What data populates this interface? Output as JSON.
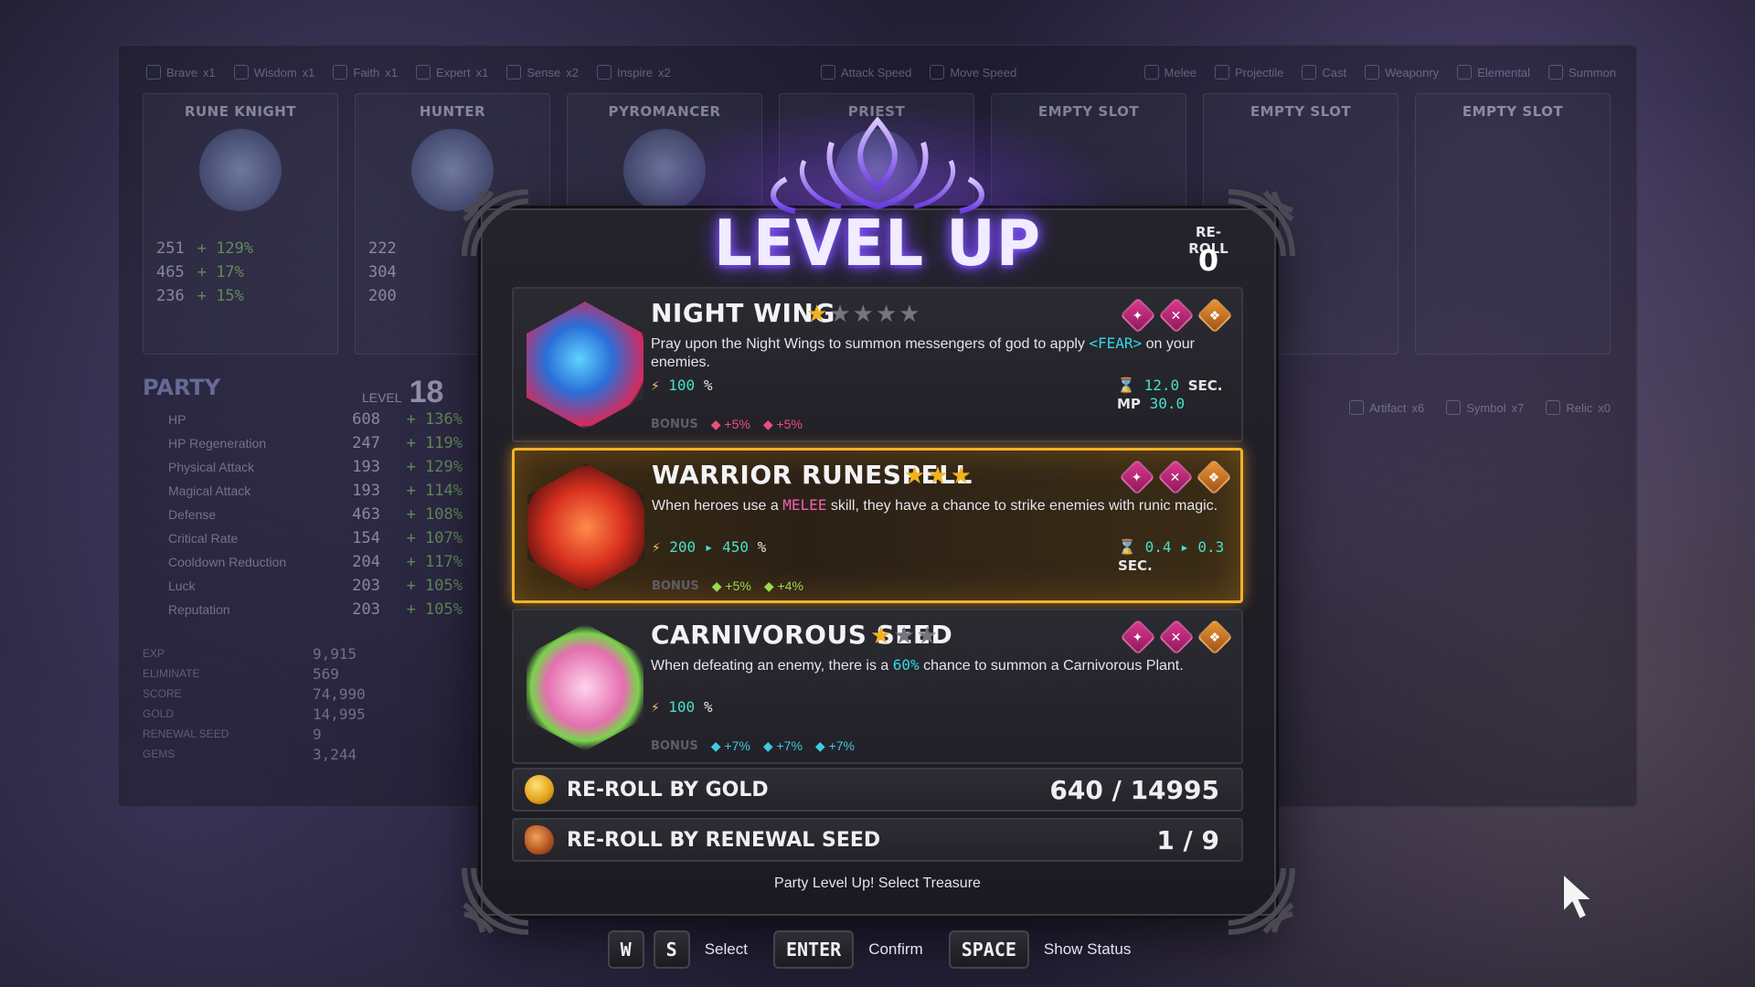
{
  "background": {
    "traits_left": [
      {
        "label": "Brave",
        "count": "x1"
      },
      {
        "label": "Wisdom",
        "count": "x1"
      },
      {
        "label": "Faith",
        "count": "x1"
      },
      {
        "label": "Expert",
        "count": "x1"
      },
      {
        "label": "Sense",
        "count": "x2"
      },
      {
        "label": "Inspire",
        "count": "x2"
      }
    ],
    "traits_mid": [
      "Attack Speed",
      "Move Speed"
    ],
    "traits_right": [
      "Melee",
      "Projectile",
      "Cast",
      "Weaponry",
      "Elemental",
      "Summon"
    ],
    "heroes": [
      {
        "name": "RUNE KNIGHT",
        "stats": [
          {
            "v": "251",
            "p": "+ 129%"
          },
          {
            "v": "465",
            "p": "+ 17%"
          },
          {
            "v": "236",
            "p": "+ 15%"
          }
        ]
      },
      {
        "name": "HUNTER",
        "stats": [
          {
            "v": "222",
            "p": ""
          },
          {
            "v": "304",
            "p": ""
          },
          {
            "v": "200",
            "p": ""
          }
        ]
      },
      {
        "name": "PYROMANCER",
        "stats": []
      },
      {
        "name": "PRIEST",
        "stats": []
      },
      {
        "name": "EMPTY SLOT",
        "stats": []
      },
      {
        "name": "EMPTY SLOT",
        "stats": []
      },
      {
        "name": "EMPTY SLOT",
        "stats": []
      }
    ],
    "party": {
      "title": "PARTY",
      "level_label": "LEVEL",
      "level": "18",
      "stats": [
        {
          "label": "HP",
          "value": "608",
          "pct": "+ 136%"
        },
        {
          "label": "HP Regeneration",
          "value": "247",
          "pct": "+ 119%"
        },
        {
          "label": "Physical Attack",
          "value": "193",
          "pct": "+ 129%"
        },
        {
          "label": "Magical Attack",
          "value": "193",
          "pct": "+ 114%"
        },
        {
          "label": "Defense",
          "value": "463",
          "pct": "+ 108%"
        },
        {
          "label": "Critical Rate",
          "value": "154",
          "pct": "+ 107%"
        },
        {
          "label": "Cooldown Reduction",
          "value": "204",
          "pct": "+ 117%"
        },
        {
          "label": "Luck",
          "value": "203",
          "pct": "+ 105%"
        },
        {
          "label": "Reputation",
          "value": "203",
          "pct": "+ 105%"
        }
      ],
      "summary": [
        {
          "k": "EXP",
          "v": "9,915"
        },
        {
          "k": "ELIMINATE",
          "v": "569"
        },
        {
          "k": "SCORE",
          "v": "74,990"
        },
        {
          "k": "GOLD",
          "v": "14,995"
        },
        {
          "k": "RENEWAL SEED",
          "v": "9"
        },
        {
          "k": "GEMS",
          "v": "3,244"
        }
      ]
    },
    "treasure_counts": [
      {
        "label": "Artifact",
        "count": "x6"
      },
      {
        "label": "Symbol",
        "count": "x7"
      },
      {
        "label": "Relic",
        "count": "x0"
      }
    ]
  },
  "modal": {
    "title": "LEVEL UP",
    "reroll_label": "RE-ROLL",
    "reroll_count": "0",
    "cards": [
      {
        "name": "NIGHT WING",
        "stars_filled": 1,
        "stars_total": 5,
        "tags": [
          "projectile-icon",
          "weaponry-icon",
          "summon-icon"
        ],
        "desc_pre": "Pray upon the Night Wings to summon messengers of god to apply ",
        "desc_hl": "<FEAR>",
        "desc_post": " on your enemies.",
        "power": "100",
        "power_unit": "%",
        "cooldown": "12.0",
        "cooldown_unit": "SEC.",
        "mp_label": "MP",
        "mp": "30.0",
        "bonus_label": "BONUS",
        "bonuses": [
          {
            "v": "+5%",
            "c": "pink"
          },
          {
            "v": "+5%",
            "c": "pink"
          }
        ],
        "selected": false
      },
      {
        "name": "WARRIOR RUNESPELL",
        "stars_filled": 3,
        "stars_total": 3,
        "tags": [
          "melee-icon",
          "elemental-icon",
          "symbol-icon"
        ],
        "desc_pre": "When heroes use a ",
        "desc_hl": "MELEE",
        "desc_post": " skill, they have a chance to strike enemies with runic magic.",
        "power": "200 ▸ 450",
        "power_unit": "%",
        "cooldown": "0.4 ▸ 0.3",
        "cooldown_unit": "SEC.",
        "mp_label": "",
        "mp": "",
        "bonus_label": "BONUS",
        "bonuses": [
          {
            "v": "+5%",
            "c": "green"
          },
          {
            "v": "+4%",
            "c": "green"
          }
        ],
        "selected": true
      },
      {
        "name": "CARNIVOROUS SEED",
        "stars_filled": 1,
        "stars_total": 3,
        "tags": [
          "cast-icon",
          "weaponry-icon",
          "summon-icon"
        ],
        "desc_pre": "When defeating an enemy, there is a ",
        "desc_hl": "60%",
        "desc_post": " chance to summon a Carnivorous Plant.",
        "power": "100",
        "power_unit": "%",
        "cooldown": "",
        "cooldown_unit": "",
        "mp_label": "",
        "mp": "",
        "bonus_label": "BONUS",
        "bonuses": [
          {
            "v": "+7%",
            "c": "cyan"
          },
          {
            "v": "+7%",
            "c": "cyan"
          },
          {
            "v": "+7%",
            "c": "cyan"
          }
        ],
        "selected": false
      }
    ],
    "reroll_gold": {
      "label": "RE-ROLL BY GOLD",
      "value": "640 / 14995"
    },
    "reroll_seed": {
      "label": "RE-ROLL BY RENEWAL SEED",
      "value": "1 / 9"
    },
    "hint": "Party Level Up! Select Treasure"
  },
  "controls": [
    {
      "keys": [
        "W",
        "S"
      ],
      "label": "Select"
    },
    {
      "keys": [
        "ENTER"
      ],
      "label": "Confirm"
    },
    {
      "keys": [
        "SPACE"
      ],
      "label": "Show Status"
    }
  ],
  "colors": {
    "accent_gold": "#f2b227",
    "title_glow": "#8a5cff",
    "cyan": "#35d6e6",
    "pink": "#ef62b5",
    "green": "#7fd05a"
  }
}
